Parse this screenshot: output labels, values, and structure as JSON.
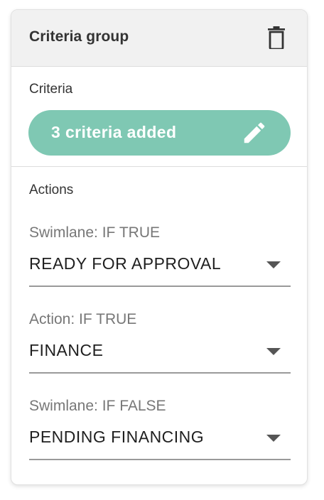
{
  "card": {
    "title": "Criteria group",
    "delete_icon": "trash-icon"
  },
  "criteria": {
    "label": "Criteria",
    "pill_text": "3 criteria added",
    "edit_icon": "pencil-icon",
    "pill_color": "#7fc8b3"
  },
  "actions": {
    "label": "Actions",
    "fields": [
      {
        "label": "Swimlane: IF TRUE",
        "value": "READY FOR APPROVAL"
      },
      {
        "label": "Action: IF TRUE",
        "value": "FINANCE"
      },
      {
        "label": "Swimlane: IF FALSE",
        "value": "PENDING FINANCING"
      }
    ]
  }
}
